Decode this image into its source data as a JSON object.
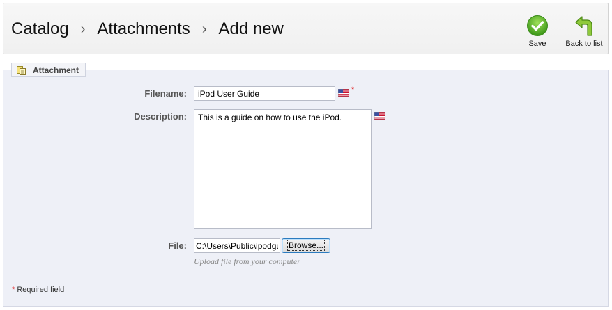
{
  "header": {
    "breadcrumb": [
      "Catalog",
      "Attachments",
      "Add new"
    ],
    "separator": "›",
    "actions": {
      "save_label": "Save",
      "back_label": "Back to list"
    }
  },
  "form": {
    "legend": "Attachment",
    "filename": {
      "label": "Filename:",
      "value": "iPod User Guide",
      "required_mark": "*"
    },
    "description": {
      "label": "Description:",
      "value": "This is a guide on how to use the iPod."
    },
    "file": {
      "label": "File:",
      "value": "C:\\Users\\Public\\ipodgu",
      "browse_label": "Browse...",
      "hint": "Upload file from your computer"
    },
    "required_note": {
      "star": "*",
      "text": " Required field"
    }
  },
  "colors": {
    "save_green": "#5cb82a",
    "back_green": "#7ab32e",
    "required_red": "#dd0000",
    "fieldset_bg": "#eef0f7"
  },
  "icons": {
    "save": "checkmark-circle-icon",
    "back": "return-arrow-icon",
    "legend": "attachment-icon",
    "language": "us-flag-icon"
  }
}
